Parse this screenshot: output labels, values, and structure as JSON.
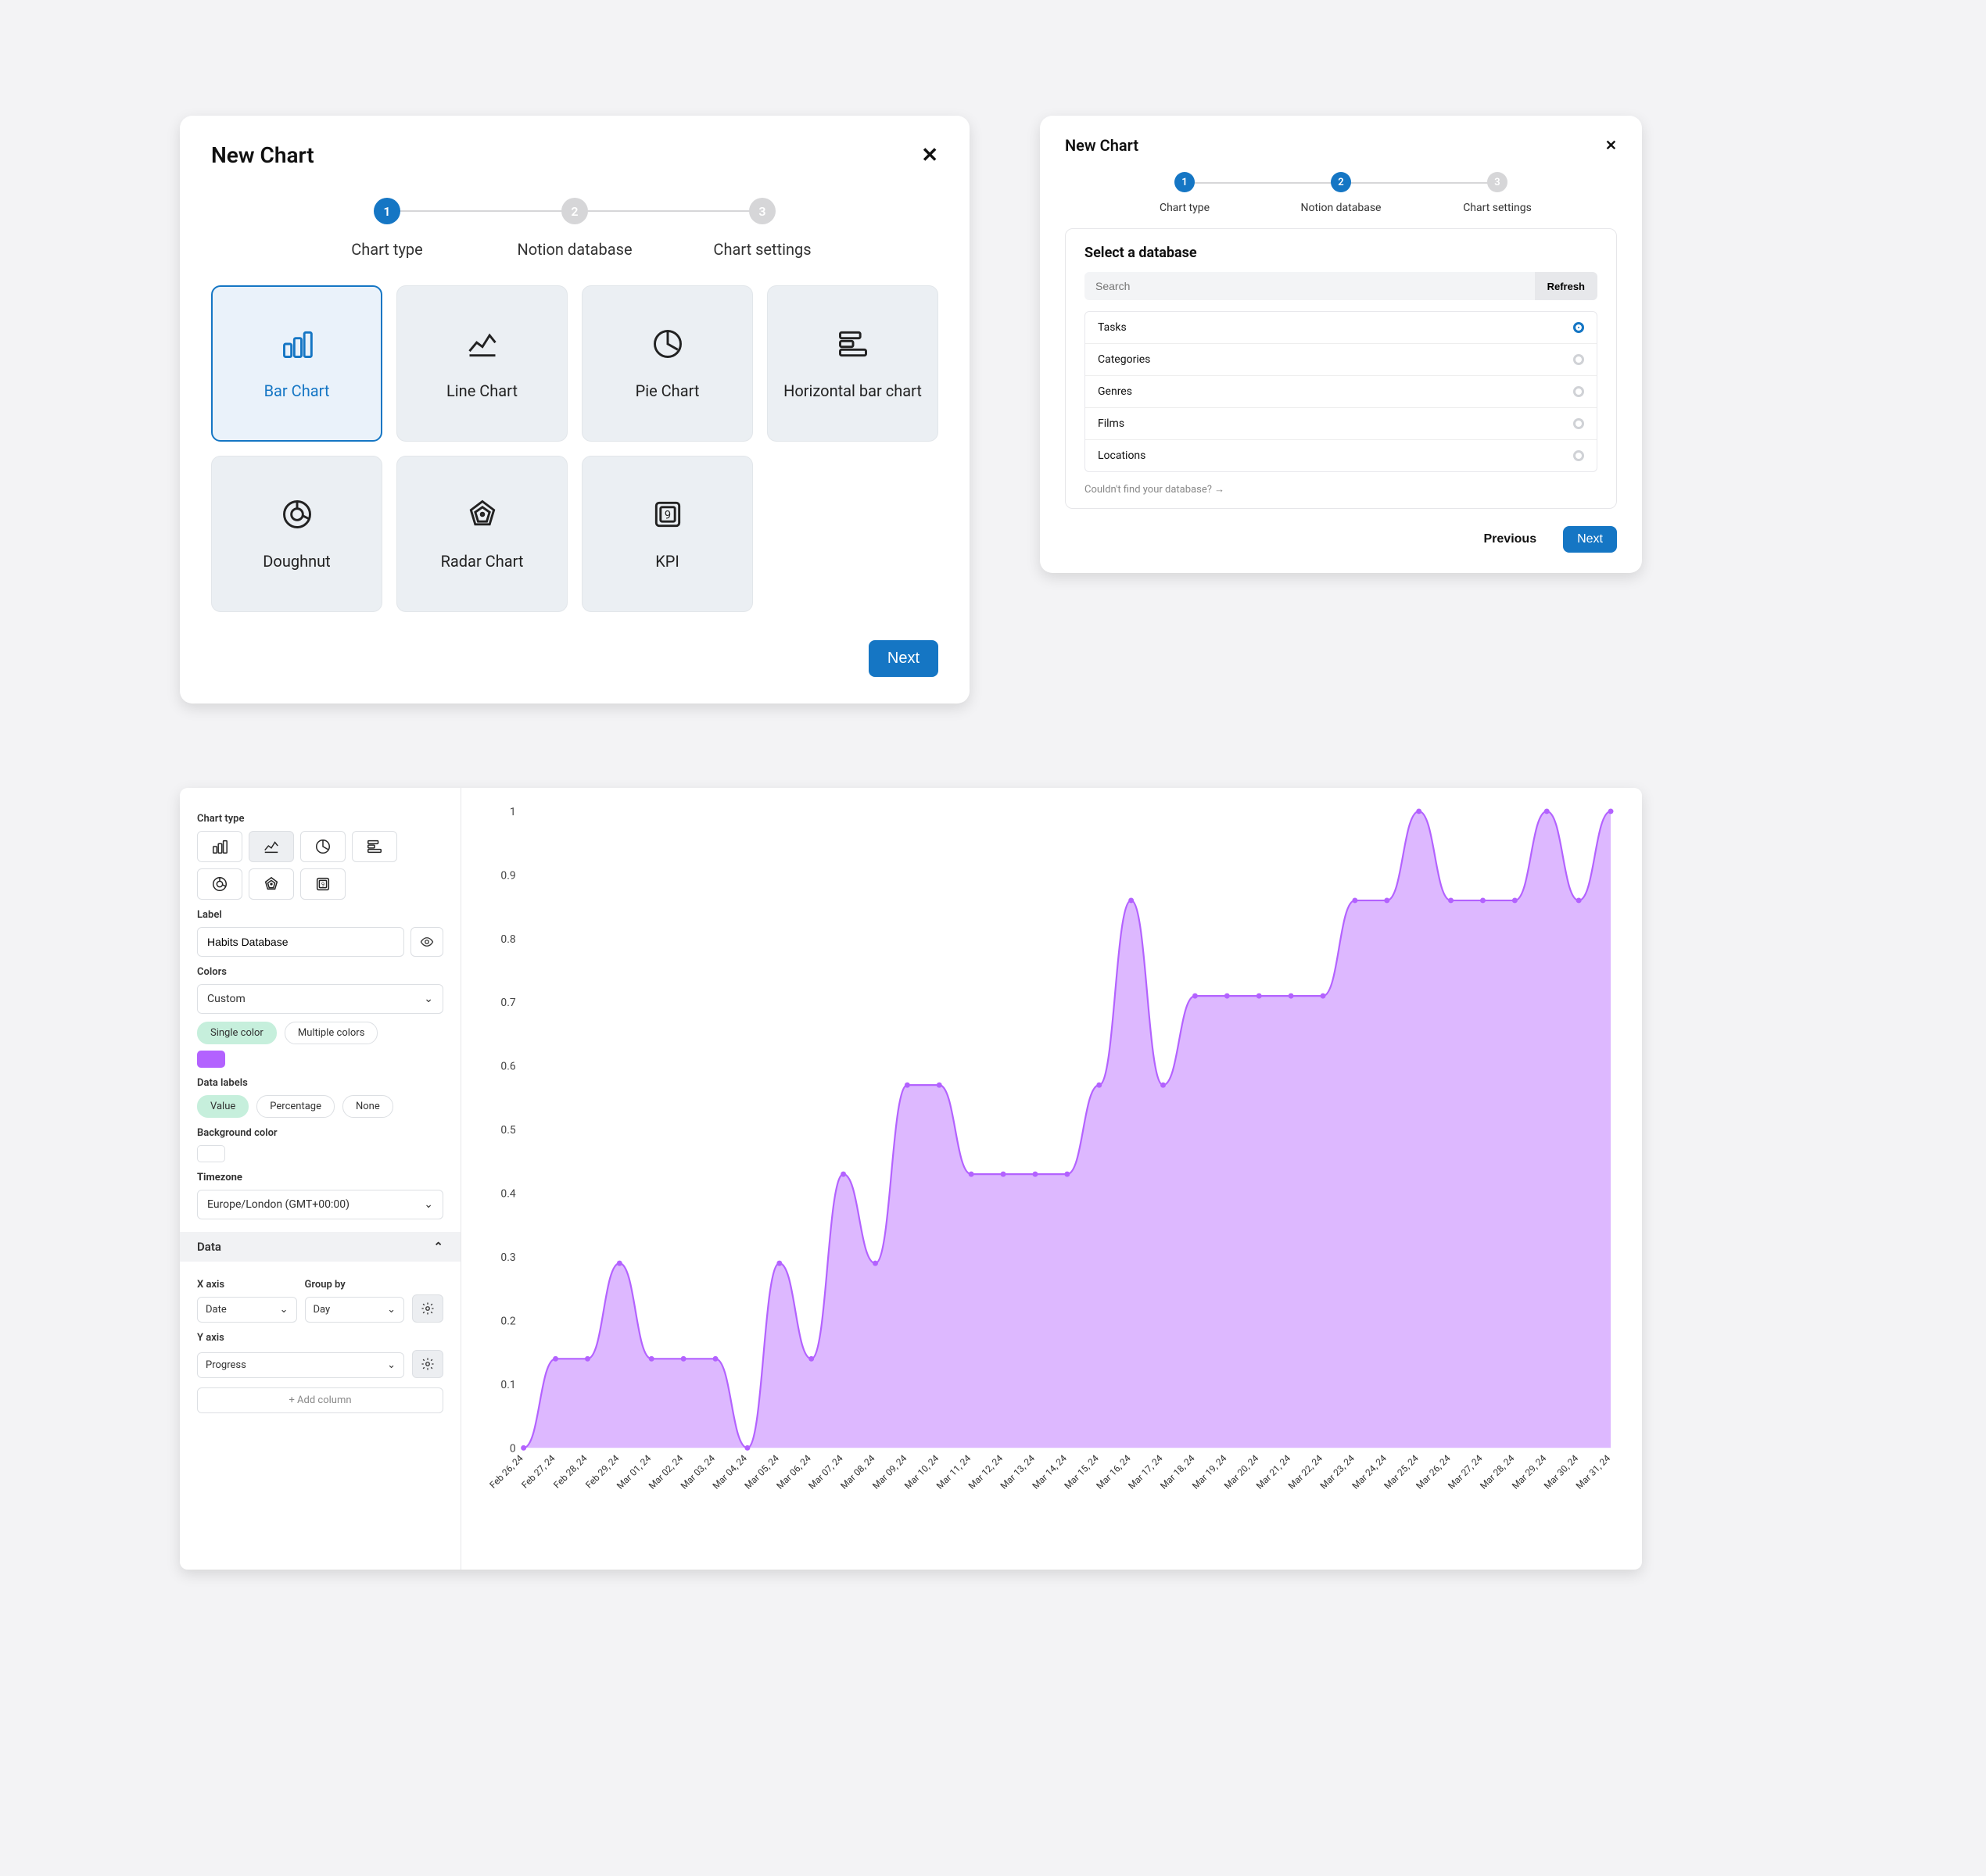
{
  "modal1": {
    "title": "New Chart",
    "steps": [
      {
        "num": "1",
        "label": "Chart type",
        "active": true
      },
      {
        "num": "2",
        "label": "Notion database",
        "active": false
      },
      {
        "num": "3",
        "label": "Chart settings",
        "active": false
      }
    ],
    "tiles": [
      {
        "name": "bar",
        "label": "Bar Chart",
        "selected": true
      },
      {
        "name": "line",
        "label": "Line Chart"
      },
      {
        "name": "pie",
        "label": "Pie Chart"
      },
      {
        "name": "hbar",
        "label": "Horizontal bar chart"
      },
      {
        "name": "doughnut",
        "label": "Doughnut"
      },
      {
        "name": "radar",
        "label": "Radar Chart"
      },
      {
        "name": "kpi",
        "label": "KPI"
      }
    ],
    "next": "Next"
  },
  "modal2": {
    "title": "New Chart",
    "steps": [
      {
        "num": "1",
        "label": "Chart type",
        "active": true
      },
      {
        "num": "2",
        "label": "Notion database",
        "active": true
      },
      {
        "num": "3",
        "label": "Chart settings",
        "active": false
      }
    ],
    "panel_title": "Select a database",
    "search_placeholder": "Search",
    "refresh_label": "Refresh",
    "databases": [
      "Tasks",
      "Categories",
      "Genres",
      "Films",
      "Locations"
    ],
    "selected_db": "Tasks",
    "hint": "Couldn't find your database? →",
    "prev": "Previous",
    "next": "Next"
  },
  "settings": {
    "chart_type_label": "Chart type",
    "mini_types": [
      "bar",
      "line",
      "pie",
      "hbar",
      "doughnut",
      "radar",
      "kpi"
    ],
    "mini_selected": "line",
    "label_label": "Label",
    "label_value": "Habits Database",
    "colors_label": "Colors",
    "colors_value": "Custom",
    "color_mode_single": "Single color",
    "color_mode_multi": "Multiple colors",
    "color_hex": "#b362ff",
    "data_labels_label": "Data labels",
    "data_labels": [
      "Value",
      "Percentage",
      "None"
    ],
    "data_labels_selected": "Value",
    "bg_label": "Background color",
    "bg_hex": "#ffffff",
    "tz_label": "Timezone",
    "tz_value": "Europe/London (GMT+00:00)",
    "data_header": "Data",
    "xaxis_label": "X axis",
    "xaxis_value": "Date",
    "groupby_label": "Group by",
    "groupby_value": "Day",
    "yaxis_label": "Y axis",
    "yaxis_value": "Progress",
    "add_col": "+ Add column"
  },
  "chart_data": {
    "type": "area",
    "title": "",
    "xlabel": "",
    "ylabel": "",
    "ylim": [
      0,
      1
    ],
    "yticks": [
      0,
      0.1,
      0.2,
      0.3,
      0.4,
      0.5,
      0.6,
      0.7,
      0.8,
      0.9,
      1
    ],
    "color": "#b362ff",
    "categories": [
      "Feb 26, 24",
      "Feb 27, 24",
      "Feb 28, 24",
      "Feb 29, 24",
      "Mar 01, 24",
      "Mar 02, 24",
      "Mar 03, 24",
      "Mar 04, 24",
      "Mar 05, 24",
      "Mar 06, 24",
      "Mar 07, 24",
      "Mar 08, 24",
      "Mar 09, 24",
      "Mar 10, 24",
      "Mar 11, 24",
      "Mar 12, 24",
      "Mar 13, 24",
      "Mar 14, 24",
      "Mar 15, 24",
      "Mar 16, 24",
      "Mar 17, 24",
      "Mar 18, 24",
      "Mar 19, 24",
      "Mar 20, 24",
      "Mar 21, 24",
      "Mar 22, 24",
      "Mar 23, 24",
      "Mar 24, 24",
      "Mar 25, 24",
      "Mar 26, 24",
      "Mar 27, 24",
      "Mar 28, 24",
      "Mar 29, 24",
      "Mar 30, 24",
      "Mar 31, 24"
    ],
    "values": [
      0.0,
      0.14,
      0.14,
      0.29,
      0.14,
      0.14,
      0.14,
      0.0,
      0.29,
      0.14,
      0.43,
      0.29,
      0.57,
      0.57,
      0.43,
      0.43,
      0.43,
      0.43,
      0.57,
      0.86,
      0.57,
      0.71,
      0.71,
      0.71,
      0.71,
      0.71,
      0.86,
      0.86,
      1.0,
      0.86,
      0.86,
      0.86,
      1.0,
      0.86,
      1.0
    ]
  }
}
